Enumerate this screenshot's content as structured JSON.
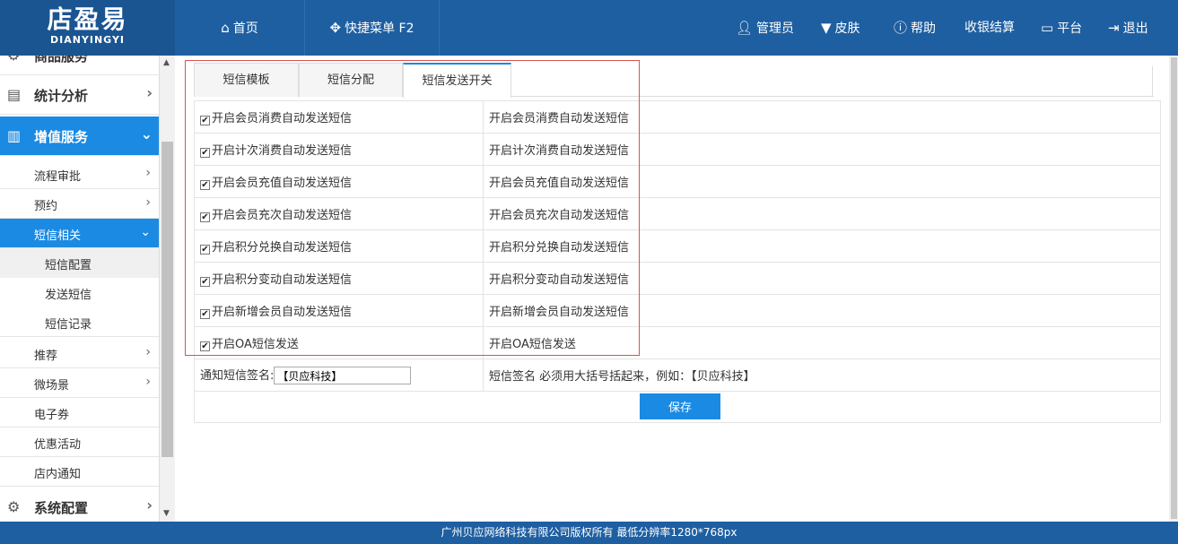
{
  "header": {
    "logo_zh": "店盈易",
    "logo_en": "DIANYINGYI",
    "nav": {
      "home": "首页",
      "quick_menu": "快捷菜单 F2",
      "admin": "管理员",
      "skin": "皮肤",
      "help": "帮助",
      "checkout": "收银结算",
      "platform": "平台",
      "logout": "退出"
    }
  },
  "sidebar": {
    "partial_top": "商品服务",
    "stats": "统计分析",
    "value_added": "增值服务",
    "sub": {
      "approval": "流程审批",
      "booking": "预约",
      "sms": "短信相关",
      "sms_config": "短信配置",
      "send_sms": "发送短信",
      "sms_records": "短信记录",
      "recommend": "推荐",
      "micro_scene": "微场景",
      "e_coupon": "电子券",
      "promotions": "优惠活动",
      "store_notice": "店内通知"
    },
    "system_config": "系统配置"
  },
  "tabs": [
    "短信模板",
    "短信分配",
    "短信发送开关"
  ],
  "active_tab": "短信发送开关",
  "switches": [
    {
      "label": "开启会员消费自动发送短信",
      "desc": "开启会员消费自动发送短信",
      "checked": true
    },
    {
      "label": "开启计次消费自动发送短信",
      "desc": "开启计次消费自动发送短信",
      "checked": true
    },
    {
      "label": "开启会员充值自动发送短信",
      "desc": "开启会员充值自动发送短信",
      "checked": true
    },
    {
      "label": "开启会员充次自动发送短信",
      "desc": "开启会员充次自动发送短信",
      "checked": true
    },
    {
      "label": "开启积分兑换自动发送短信",
      "desc": "开启积分兑换自动发送短信",
      "checked": true
    },
    {
      "label": "开启积分变动自动发送短信",
      "desc": "开启积分变动自动发送短信",
      "checked": true
    },
    {
      "label": "开启新增会员自动发送短信",
      "desc": "开启新增会员自动发送短信",
      "checked": true
    },
    {
      "label": "开启OA短信发送",
      "desc": "开启OA短信发送",
      "checked": true
    }
  ],
  "signature": {
    "label": "通知短信签名:",
    "value": "【贝应科技】",
    "hint": "短信签名 必须用大括号括起来，例如：【贝应科技】"
  },
  "save_label": "保存",
  "footer": "广州贝应网络科技有限公司版权所有 最低分辨率1280*768px",
  "colors": {
    "header": "#1e5fa1",
    "accent": "#1b8ae3",
    "highlight": "#d9534f"
  }
}
